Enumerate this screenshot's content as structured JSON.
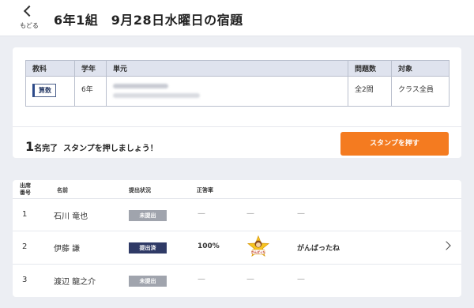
{
  "header": {
    "back_label": "もどる",
    "title": "6年1組　9月28日水曜日の宿題"
  },
  "assignment_table": {
    "columns": [
      "教科",
      "学年",
      "単元",
      "問題数",
      "対象"
    ],
    "row": {
      "subject": "算数",
      "grade": "6年",
      "question_count": "全2問",
      "target": "クラス全員"
    }
  },
  "summary": {
    "count": "1",
    "count_suffix": "名完了",
    "message": "スタンプを押しましょう！",
    "stamp_button": "スタンプを押す"
  },
  "student_list": {
    "columns": {
      "number": "出席番号",
      "name": "名前",
      "status": "提出状況",
      "score": "正答率"
    },
    "rows": [
      {
        "number": "1",
        "name": "石川 竜也",
        "status": "未提出",
        "score": "—",
        "stamp": "—",
        "comment": "—"
      },
      {
        "number": "2",
        "name": "伊藤 謙",
        "status": "提出済",
        "score": "100%",
        "sticker_text": "がんばった",
        "comment": "がんばったね"
      },
      {
        "number": "3",
        "name": "渡辺 龍之介",
        "status": "未提出",
        "score": "—",
        "stamp": "—",
        "comment": "—"
      }
    ]
  },
  "colors": {
    "accent_orange": "#f47b20",
    "submitted_navy": "#2f3a66",
    "pending_gray": "#a0a4ad",
    "table_header": "#dfe3ee"
  }
}
